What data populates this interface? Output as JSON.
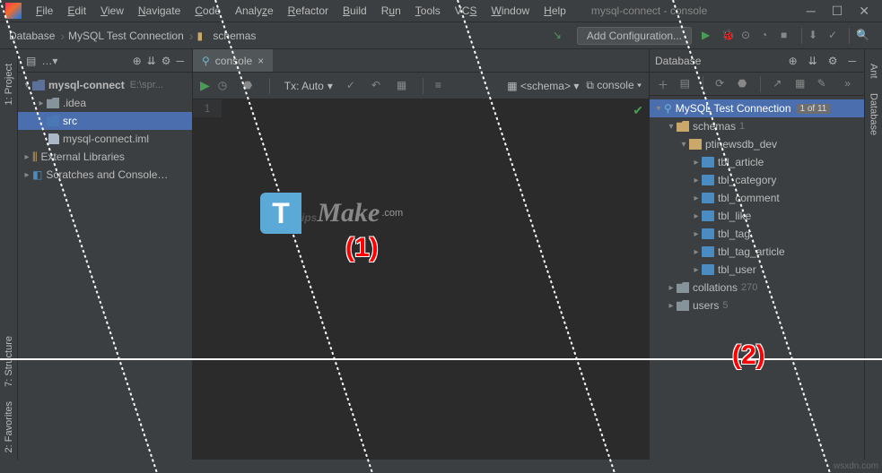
{
  "window": {
    "title": "mysql-connect - console"
  },
  "menu": [
    "File",
    "Edit",
    "View",
    "Navigate",
    "Code",
    "Analyze",
    "Refactor",
    "Build",
    "Run",
    "Tools",
    "VCS",
    "Window",
    "Help"
  ],
  "breadcrumbs": [
    "Database",
    "MySQL Test Connection",
    "schemas"
  ],
  "navbar": {
    "add_config": "Add Configuration..."
  },
  "project": {
    "root": {
      "name": "mysql-connect",
      "path": "E:\\spr..."
    },
    "children": [
      {
        "name": ".idea",
        "type": "folder",
        "level": 1
      },
      {
        "name": "src",
        "type": "folder",
        "level": 1,
        "selected": true
      },
      {
        "name": "mysql-connect.iml",
        "type": "file",
        "level": 1
      }
    ],
    "ext_lib": "External Libraries",
    "scratch": "Scratches and Console…"
  },
  "editor": {
    "tab": "console",
    "line": "1",
    "tx": "Tx: Auto",
    "schema_sel": "<schema>",
    "console_sel": "console"
  },
  "database": {
    "title": "Database",
    "conn": {
      "name": "MySQL Test Connection",
      "badge": "1 of 11"
    },
    "schemas": {
      "label": "schemas",
      "count": "1"
    },
    "db": "ptinewsdb_dev",
    "tables": [
      "tbl_article",
      "tbl_category",
      "tbl_comment",
      "tbl_like",
      "tbl_tag",
      "tbl_tag_article",
      "tbl_user"
    ],
    "collations": {
      "label": "collations",
      "count": "270"
    },
    "users": {
      "label": "users",
      "count": "5"
    }
  },
  "sidetabs": {
    "left": [
      "1: Project",
      "7: Structure",
      "2: Favorites"
    ],
    "right": [
      "Ant",
      "Database"
    ]
  },
  "watermark": {
    "text": "ipsMake",
    "suffix": ".com"
  },
  "annotations": {
    "one": "(1)",
    "two": "(2)"
  },
  "footer": "wsxdn.com"
}
